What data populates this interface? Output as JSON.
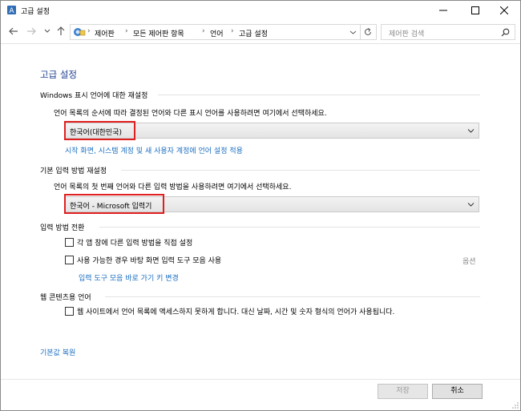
{
  "window": {
    "title": "고급 설정"
  },
  "nav": {
    "breadcrumbs": [
      "제어판",
      "모든 제어판 항목",
      "언어",
      "고급 설정"
    ],
    "search_placeholder": "제어판 검색"
  },
  "page": {
    "title": "고급 설정"
  },
  "display_language": {
    "heading": "Windows 표시 언어에 대한 재설정",
    "description": "언어 목록의 순서에 따라 결정된 언어와 다른 표시 언어를 사용하려면 여기에서 선택하세요.",
    "selected": "한국어(대한민국)",
    "link": "시작 화면, 시스템 계정 및 새 사용자 계정에 언어 설정 적용"
  },
  "input_method": {
    "heading": "기본 입력 방법 재설정",
    "description": "언어 목록의 첫 번째 언어와 다른 입력 방법을 사용하려면 여기에서 선택하세요.",
    "selected": "한국어 - Microsoft 입력기"
  },
  "switching": {
    "heading": "입력 방법 전환",
    "checkbox1": "각 앱 창에 다른 입력 방법을 직접 설정",
    "checkbox2": "사용 가능한 경우 바탕 화면 입력 도구 모음 사용",
    "options": "옵션",
    "hotkey_link": "입력 도구 모음 바로 가기 키 변경"
  },
  "web_content": {
    "heading": "웹 콘텐츠용 언어",
    "checkbox": "웹 사이트에서 언어 목록에 액세스하지 못하게 합니다. 대신 날짜, 시간 및 숫자 형식의 언어가 사용됩니다."
  },
  "restore_link": "기본값 복원",
  "buttons": {
    "save": "저장",
    "cancel": "취소"
  }
}
